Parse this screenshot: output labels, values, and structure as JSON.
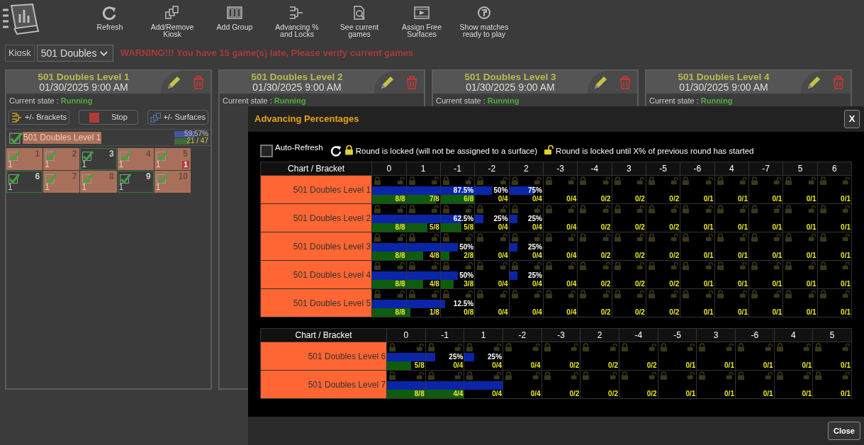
{
  "toolbar": [
    {
      "kind": "refresh",
      "label": "Refresh"
    },
    {
      "kind": "kiosk",
      "label": "Add/Remove Kiosk"
    },
    {
      "kind": "group",
      "label": "Add Group"
    },
    {
      "kind": "bracket",
      "label": "Advancing % and Locks"
    },
    {
      "kind": "search",
      "label": "See current games"
    },
    {
      "kind": "film",
      "label": "Assign Free Surfaces"
    },
    {
      "kind": "play",
      "label": "Show matches ready to play"
    }
  ],
  "kiosk": {
    "label": "Kiosk",
    "value": "501 Doubles"
  },
  "warning": "WARNING!!! You have 15 game(s) late, Please verify current games",
  "cards": [
    {
      "title": "501 Doubles Level 1",
      "date": "01/30/2025 9:00 AM",
      "state_label": "Current state :",
      "state": "Running",
      "buttons": [
        {
          "kind": "brackets",
          "label": "+/- Brackets"
        },
        {
          "kind": "stop",
          "label": "Stop"
        },
        {
          "kind": "surfaces",
          "label": "+/- Surfaces"
        }
      ],
      "chart": {
        "name": "501 Doubles Level 1",
        "checked": true,
        "percent": {
          "level": 0.5957,
          "reading": "59.57%"
        },
        "count": {
          "level": 0.4468,
          "reading": "21 / 47"
        }
      },
      "tiles": [
        {
          "number": "1",
          "count": "1",
          "checked": true,
          "done": true
        },
        {
          "number": "2",
          "count": "1",
          "checked": true,
          "done": true
        },
        {
          "number": "3",
          "count": "1",
          "checked": true,
          "done": false
        },
        {
          "number": "4",
          "count": "1",
          "checked": true,
          "done": true
        },
        {
          "number": "5",
          "count": "1",
          "checked": true,
          "done": true,
          "late": "1"
        },
        {
          "number": "6",
          "count": "1",
          "checked": true,
          "done": false
        },
        {
          "number": "7",
          "count": "1",
          "checked": true,
          "done": true
        },
        {
          "number": "8",
          "count": "1",
          "checked": true,
          "done": true
        },
        {
          "number": "9",
          "count": "1",
          "checked": true,
          "done": false
        },
        {
          "number": "10",
          "count": "1",
          "checked": true,
          "done": true
        }
      ]
    },
    {
      "title": "501 Doubles Level 2",
      "date": "01/30/2025 9:00 AM",
      "state_label": "Current state :",
      "state": "Running"
    },
    {
      "title": "501 Doubles Level 3",
      "date": "01/30/2025 9:00 AM",
      "state_label": "Current state :",
      "state": "Running"
    },
    {
      "title": "501 Doubles Level 4",
      "date": "01/30/2025 9:00 AM",
      "state_label": "Current state :",
      "state": "Running"
    }
  ],
  "modal": {
    "title": "Advancing Percentages",
    "close": "X",
    "auto_refresh": {
      "label": "Auto-Refresh",
      "checked": false
    },
    "legend": [
      "Round is locked (will not be assigned to a surface)",
      "Round is locked until X% of previous round has started"
    ],
    "tables": [
      {
        "header": "Chart / Bracket",
        "columns": [
          "0",
          "1",
          "-1",
          "-2",
          "2",
          "-3",
          "-4",
          "3",
          "-5",
          "-6",
          "4",
          "-7",
          "5",
          "6"
        ],
        "rows": [
          {
            "name": "501 Doubles Level 1",
            "cells": [
              {
                "started": {
                  "level": 1
                },
                "finished": {
                  "level": 1,
                  "reading": "8/8"
                }
              },
              {
                "started": {
                  "level": 1
                },
                "finished": {
                  "level": 0.875,
                  "reading": "7/8"
                }
              },
              {
                "started": {
                  "level": 1,
                  "reading": "87.5%"
                },
                "finished": {
                  "level": 1,
                  "reading": "6/8"
                }
              },
              {
                "started": {
                  "level": 0.5,
                  "reading": "50%"
                },
                "finished": {
                  "level": 0,
                  "reading": "0/4"
                }
              },
              {
                "started": {
                  "level": 0.75,
                  "reading": "75%"
                },
                "finished": {
                  "level": 0,
                  "reading": "0/4"
                }
              },
              {
                "started": {
                  "level": 0
                },
                "finished": {
                  "level": 0,
                  "reading": "0/4"
                }
              },
              {
                "started": {
                  "level": 0
                },
                "finished": {
                  "level": 0,
                  "reading": "0/2"
                }
              },
              {
                "started": {
                  "level": 0
                },
                "finished": {
                  "level": 0,
                  "reading": "0/2"
                }
              },
              {
                "started": {
                  "level": 0
                },
                "finished": {
                  "level": 0,
                  "reading": "0/2"
                }
              },
              {
                "started": {
                  "level": 0
                },
                "finished": {
                  "level": 0,
                  "reading": "0/1"
                }
              },
              {
                "started": {
                  "level": 0
                },
                "finished": {
                  "level": 0,
                  "reading": "0/1"
                }
              },
              {
                "started": {
                  "level": 0
                },
                "finished": {
                  "level": 0,
                  "reading": "0/1"
                }
              },
              {
                "started": {
                  "level": 0
                },
                "finished": {
                  "level": 0,
                  "reading": "0/1"
                }
              },
              {
                "started": {
                  "level": 0
                },
                "finished": {
                  "level": 0,
                  "reading": "0/1"
                }
              }
            ]
          },
          {
            "name": "501 Doubles Level 2",
            "cells": [
              {
                "started": {
                  "level": 1
                },
                "finished": {
                  "level": 1,
                  "reading": "8/8"
                }
              },
              {
                "started": {
                  "level": 1
                },
                "finished": {
                  "level": 0.625,
                  "reading": "5/8"
                }
              },
              {
                "started": {
                  "level": 0.625,
                  "reading": "62.5%"
                },
                "finished": {
                  "level": 0.625,
                  "reading": "5/8"
                }
              },
              {
                "started": {
                  "level": 0.25,
                  "reading": "25%"
                },
                "finished": {
                  "level": 0,
                  "reading": "0/4"
                }
              },
              {
                "started": {
                  "level": 0.25,
                  "reading": "25%"
                },
                "finished": {
                  "level": 0,
                  "reading": "0/4"
                }
              },
              {
                "started": {
                  "level": 0
                },
                "finished": {
                  "level": 0,
                  "reading": "0/4"
                }
              },
              {
                "started": {
                  "level": 0
                },
                "finished": {
                  "level": 0,
                  "reading": "0/2"
                }
              },
              {
                "started": {
                  "level": 0
                },
                "finished": {
                  "level": 0,
                  "reading": "0/2"
                }
              },
              {
                "started": {
                  "level": 0
                },
                "finished": {
                  "level": 0,
                  "reading": "0/2"
                }
              },
              {
                "started": {
                  "level": 0
                },
                "finished": {
                  "level": 0,
                  "reading": "0/1"
                }
              },
              {
                "started": {
                  "level": 0
                },
                "finished": {
                  "level": 0,
                  "reading": "0/1"
                }
              },
              {
                "started": {
                  "level": 0
                },
                "finished": {
                  "level": 0,
                  "reading": "0/1"
                }
              },
              {
                "started": {
                  "level": 0
                },
                "finished": {
                  "level": 0,
                  "reading": "0/1"
                }
              },
              {
                "started": {
                  "level": 0
                },
                "finished": {
                  "level": 0,
                  "reading": "0/1"
                }
              }
            ]
          },
          {
            "name": "501 Doubles Level 3",
            "cells": [
              {
                "started": {
                  "level": 1
                },
                "finished": {
                  "level": 1,
                  "reading": "8/8"
                }
              },
              {
                "started": {
                  "level": 1
                },
                "finished": {
                  "level": 0.5,
                  "reading": "4/8"
                }
              },
              {
                "started": {
                  "level": 0.5,
                  "reading": "50%"
                },
                "finished": {
                  "level": 0.25,
                  "reading": "2/8"
                }
              },
              {
                "started": {
                  "level": 0
                },
                "finished": {
                  "level": 0,
                  "reading": "0/4"
                }
              },
              {
                "started": {
                  "level": 0.25,
                  "reading": "25%"
                },
                "finished": {
                  "level": 0,
                  "reading": "0/4"
                }
              },
              {
                "started": {
                  "level": 0
                },
                "finished": {
                  "level": 0,
                  "reading": "0/4"
                }
              },
              {
                "started": {
                  "level": 0
                },
                "finished": {
                  "level": 0,
                  "reading": "0/2"
                }
              },
              {
                "started": {
                  "level": 0
                },
                "finished": {
                  "level": 0,
                  "reading": "0/2"
                }
              },
              {
                "started": {
                  "level": 0
                },
                "finished": {
                  "level": 0,
                  "reading": "0/2"
                }
              },
              {
                "started": {
                  "level": 0
                },
                "finished": {
                  "level": 0,
                  "reading": "0/1"
                }
              },
              {
                "started": {
                  "level": 0
                },
                "finished": {
                  "level": 0,
                  "reading": "0/1"
                }
              },
              {
                "started": {
                  "level": 0
                },
                "finished": {
                  "level": 0,
                  "reading": "0/1"
                }
              },
              {
                "started": {
                  "level": 0
                },
                "finished": {
                  "level": 0,
                  "reading": "0/1"
                }
              },
              {
                "started": {
                  "level": 0
                },
                "finished": {
                  "level": 0,
                  "reading": "0/1"
                }
              }
            ]
          },
          {
            "name": "501 Doubles Level 4",
            "cells": [
              {
                "started": {
                  "level": 1
                },
                "finished": {
                  "level": 1,
                  "reading": "8/8"
                }
              },
              {
                "started": {
                  "level": 1
                },
                "finished": {
                  "level": 0.5,
                  "reading": "4/8"
                }
              },
              {
                "started": {
                  "level": 0.5,
                  "reading": "50%"
                },
                "finished": {
                  "level": 0.375,
                  "reading": "3/8"
                }
              },
              {
                "started": {
                  "level": 0
                },
                "finished": {
                  "level": 0,
                  "reading": "0/4"
                }
              },
              {
                "started": {
                  "level": 0.25,
                  "reading": "25%"
                },
                "finished": {
                  "level": 0,
                  "reading": "0/4"
                }
              },
              {
                "started": {
                  "level": 0
                },
                "finished": {
                  "level": 0,
                  "reading": "0/4"
                }
              },
              {
                "started": {
                  "level": 0
                },
                "finished": {
                  "level": 0,
                  "reading": "0/2"
                }
              },
              {
                "started": {
                  "level": 0
                },
                "finished": {
                  "level": 0,
                  "reading": "0/2"
                }
              },
              {
                "started": {
                  "level": 0
                },
                "finished": {
                  "level": 0,
                  "reading": "0/2"
                }
              },
              {
                "started": {
                  "level": 0
                },
                "finished": {
                  "level": 0,
                  "reading": "0/1"
                }
              },
              {
                "started": {
                  "level": 0
                },
                "finished": {
                  "level": 0,
                  "reading": "0/1"
                }
              },
              {
                "started": {
                  "level": 0
                },
                "finished": {
                  "level": 0,
                  "reading": "0/1"
                }
              },
              {
                "started": {
                  "level": 0
                },
                "finished": {
                  "level": 0,
                  "reading": "0/1"
                }
              },
              {
                "started": {
                  "level": 0
                },
                "finished": {
                  "level": 0,
                  "reading": "0/1"
                }
              }
            ]
          },
          {
            "name": "501 Doubles Level 5",
            "cells": [
              {
                "started": {
                  "level": 1
                },
                "finished": {
                  "level": 1,
                  "reading": "8/8"
                }
              },
              {
                "started": {
                  "level": 1
                },
                "finished": {
                  "level": 0.125,
                  "reading": "1/8"
                }
              },
              {
                "started": {
                  "level": 0.125,
                  "reading": "12.5%"
                },
                "finished": {
                  "level": 0,
                  "reading": "0/8"
                }
              },
              {
                "started": {
                  "level": 0
                },
                "finished": {
                  "level": 0,
                  "reading": "0/4"
                }
              },
              {
                "started": {
                  "level": 0
                },
                "finished": {
                  "level": 0,
                  "reading": "0/4"
                }
              },
              {
                "started": {
                  "level": 0
                },
                "finished": {
                  "level": 0,
                  "reading": "0/4"
                }
              },
              {
                "started": {
                  "level": 0
                },
                "finished": {
                  "level": 0,
                  "reading": "0/2"
                }
              },
              {
                "started": {
                  "level": 0
                },
                "finished": {
                  "level": 0,
                  "reading": "0/2"
                }
              },
              {
                "started": {
                  "level": 0
                },
                "finished": {
                  "level": 0,
                  "reading": "0/2"
                }
              },
              {
                "started": {
                  "level": 0
                },
                "finished": {
                  "level": 0,
                  "reading": "0/1"
                }
              },
              {
                "started": {
                  "level": 0
                },
                "finished": {
                  "level": 0,
                  "reading": "0/1"
                }
              },
              {
                "started": {
                  "level": 0
                },
                "finished": {
                  "level": 0,
                  "reading": "0/1"
                }
              },
              {
                "started": {
                  "level": 0
                },
                "finished": {
                  "level": 0,
                  "reading": "0/1"
                }
              },
              {
                "started": {
                  "level": 0
                },
                "finished": {
                  "level": 0,
                  "reading": "0/1"
                }
              }
            ]
          }
        ]
      },
      {
        "header": "Chart / Bracket",
        "columns": [
          "0",
          "-1",
          "1",
          "-2",
          "-3",
          "2",
          "-4",
          "-5",
          "3",
          "-6",
          "4",
          "5"
        ],
        "rows": [
          {
            "name": "501 Doubles Level 6",
            "cells": [
              {
                "started": {
                  "level": 1
                },
                "finished": {
                  "level": 0.625,
                  "reading": "5/8"
                }
              },
              {
                "started": {
                  "level": 0.25,
                  "reading": "25%"
                },
                "finished": {
                  "level": 0,
                  "reading": "0/4"
                }
              },
              {
                "started": {
                  "level": 0.25,
                  "reading": "25%"
                },
                "finished": {
                  "level": 0,
                  "reading": "0/4"
                }
              },
              {
                "started": {
                  "level": 0
                },
                "finished": {
                  "level": 0,
                  "reading": "0/4"
                }
              },
              {
                "started": {
                  "level": 0
                },
                "finished": {
                  "level": 0,
                  "reading": "0/2"
                }
              },
              {
                "started": {
                  "level": 0
                },
                "finished": {
                  "level": 0,
                  "reading": "0/2"
                }
              },
              {
                "started": {
                  "level": 0
                },
                "finished": {
                  "level": 0,
                  "reading": "0/2"
                }
              },
              {
                "started": {
                  "level": 0
                },
                "finished": {
                  "level": 0,
                  "reading": "0/1"
                }
              },
              {
                "started": {
                  "level": 0
                },
                "finished": {
                  "level": 0,
                  "reading": "0/1"
                }
              },
              {
                "started": {
                  "level": 0
                },
                "finished": {
                  "level": 0,
                  "reading": "0/1"
                }
              },
              {
                "started": {
                  "level": 0
                },
                "finished": {
                  "level": 0,
                  "reading": "0/1"
                }
              },
              {
                "started": {
                  "level": 0
                },
                "finished": {
                  "level": 0,
                  "reading": "0/1"
                }
              }
            ]
          },
          {
            "name": "501 Doubles Level 7",
            "cells": [
              {
                "started": {
                  "level": 1
                },
                "finished": {
                  "level": 1,
                  "reading": "8/8"
                }
              },
              {
                "started": {
                  "level": 1
                },
                "finished": {
                  "level": 1,
                  "reading": "4/4"
                }
              },
              {
                "started": {
                  "level": 1
                },
                "finished": {
                  "level": 0,
                  "reading": "0/4"
                }
              },
              {
                "started": {
                  "level": 0
                },
                "finished": {
                  "level": 0,
                  "reading": "0/4"
                }
              },
              {
                "started": {
                  "level": 0
                },
                "finished": {
                  "level": 0,
                  "reading": "0/2"
                }
              },
              {
                "started": {
                  "level": 0
                },
                "finished": {
                  "level": 0,
                  "reading": "0/2"
                }
              },
              {
                "started": {
                  "level": 0
                },
                "finished": {
                  "level": 0,
                  "reading": "0/2"
                }
              },
              {
                "started": {
                  "level": 0
                },
                "finished": {
                  "level": 0,
                  "reading": "0/1"
                }
              },
              {
                "started": {
                  "level": 0
                },
                "finished": {
                  "level": 0,
                  "reading": "0/1"
                }
              },
              {
                "started": {
                  "level": 0
                },
                "finished": {
                  "level": 0,
                  "reading": "0/1"
                }
              },
              {
                "started": {
                  "level": 0
                },
                "finished": {
                  "level": 0,
                  "reading": "0/1"
                }
              },
              {
                "started": {
                  "level": 0
                },
                "finished": {
                  "level": 0,
                  "reading": "0/1"
                }
              }
            ]
          }
        ]
      }
    ],
    "footer_button": "Close"
  }
}
